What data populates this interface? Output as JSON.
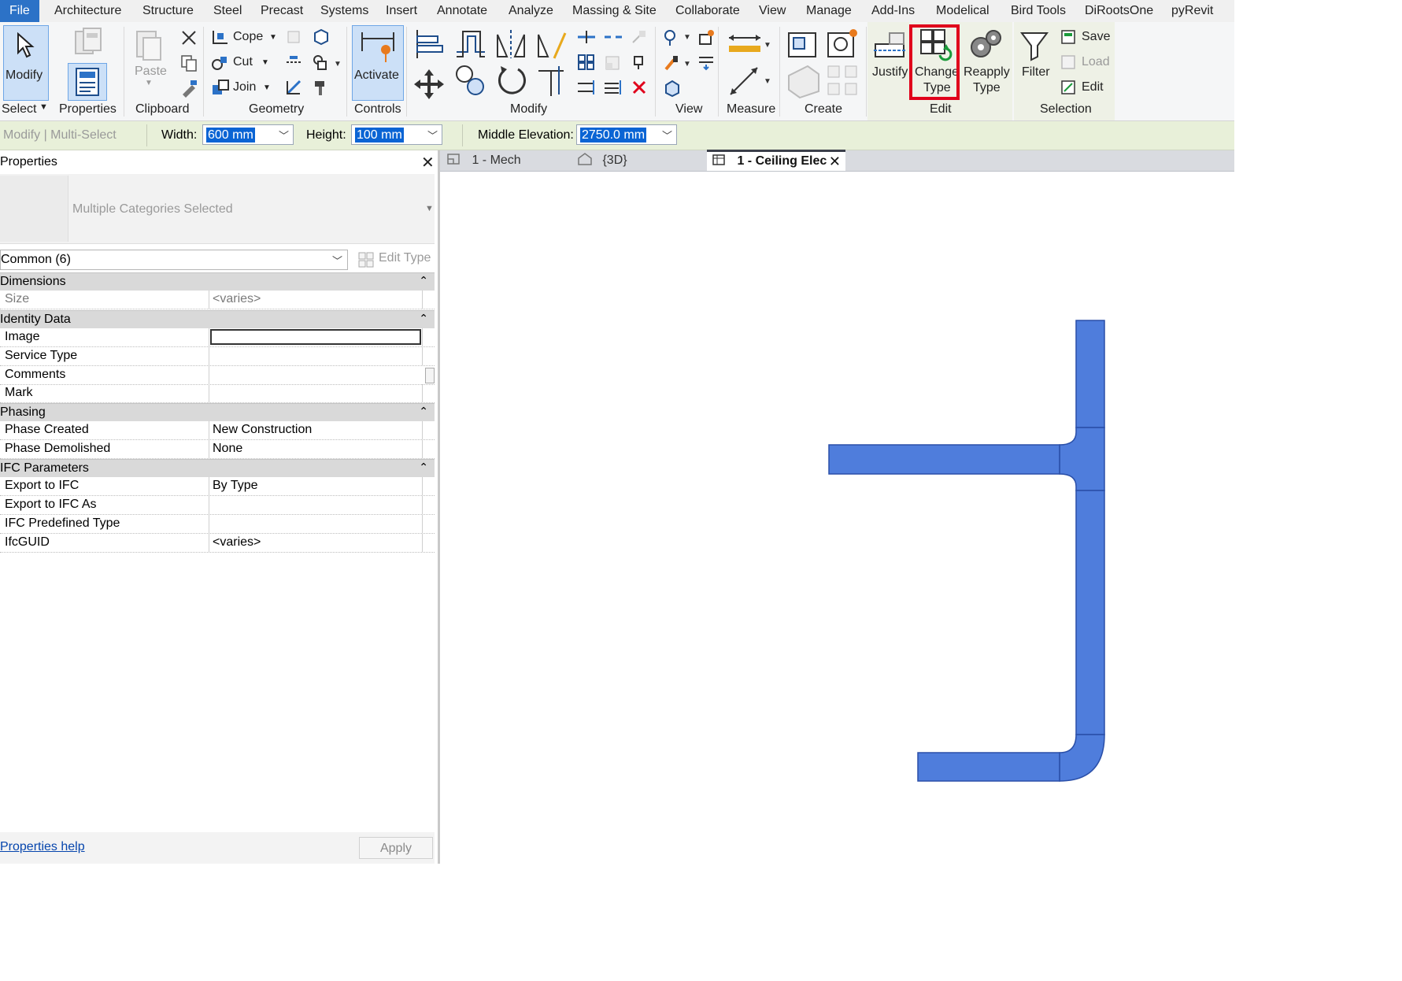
{
  "menu": {
    "items": [
      "File",
      "Architecture",
      "Structure",
      "Steel",
      "Precast",
      "Systems",
      "Insert",
      "Annotate",
      "Analyze",
      "Massing & Site",
      "Collaborate",
      "View",
      "Manage",
      "Add-Ins",
      "Modelical",
      "Bird Tools",
      "DiRootsOne",
      "pyRevit"
    ]
  },
  "ribbon": {
    "select": {
      "modify": "Modify",
      "select_label": "Select",
      "properties": "Properties"
    },
    "clipboard": {
      "paste": "Paste",
      "label": "Clipboard"
    },
    "geometry": {
      "cope": "Cope",
      "cut": "Cut",
      "join": "Join",
      "label": "Geometry"
    },
    "controls": {
      "activate": "Activate",
      "label": "Controls"
    },
    "modify_label": "Modify",
    "view_label": "View",
    "measure_label": "Measure",
    "create_label": "Create",
    "edit": {
      "justify": "Justify",
      "change_type_1": "Change",
      "change_type_2": "Type",
      "reapply_1": "Reapply",
      "reapply_2": "Type",
      "label": "Edit"
    },
    "selection": {
      "filter": "Filter",
      "save": "Save",
      "load": "Load",
      "edit": "Edit",
      "label": "Selection"
    }
  },
  "options_bar": {
    "context": "Modify | Multi-Select",
    "width_label": "Width:",
    "width_value": "600 mm",
    "height_label": "Height:",
    "height_value": "100 mm",
    "elev_label": "Middle Elevation:",
    "elev_value": "2750.0 mm"
  },
  "properties": {
    "title": "Properties",
    "type_name": "Multiple Categories Selected",
    "filter": "Common (6)",
    "edit_type": "Edit Type",
    "groups": [
      {
        "name": "Dimensions",
        "rows": [
          {
            "n": "Size",
            "v": "<varies>"
          }
        ]
      },
      {
        "name": "Identity Data",
        "rows": [
          {
            "n": "Image",
            "v": ""
          },
          {
            "n": "Service Type",
            "v": ""
          },
          {
            "n": "Comments",
            "v": ""
          },
          {
            "n": "Mark",
            "v": ""
          }
        ]
      },
      {
        "name": "Phasing",
        "rows": [
          {
            "n": "Phase Created",
            "v": "New Construction"
          },
          {
            "n": "Phase Demolished",
            "v": "None"
          }
        ]
      },
      {
        "name": "IFC Parameters",
        "rows": [
          {
            "n": "Export to IFC",
            "v": "By Type"
          },
          {
            "n": "Export to IFC As",
            "v": ""
          },
          {
            "n": "IFC Predefined Type",
            "v": ""
          },
          {
            "n": "IfcGUID",
            "v": "<varies>"
          }
        ]
      }
    ],
    "help": "Properties help",
    "apply": "Apply"
  },
  "tabs": [
    {
      "label": "1 - Mech"
    },
    {
      "label": "{3D}"
    },
    {
      "label": "1 - Ceiling Elec"
    }
  ],
  "colors": {
    "duct": "#4f7ddc",
    "duct_edge": "#2a4fa8",
    "accent": "#2c72c7",
    "highlight": "#e0001b"
  }
}
